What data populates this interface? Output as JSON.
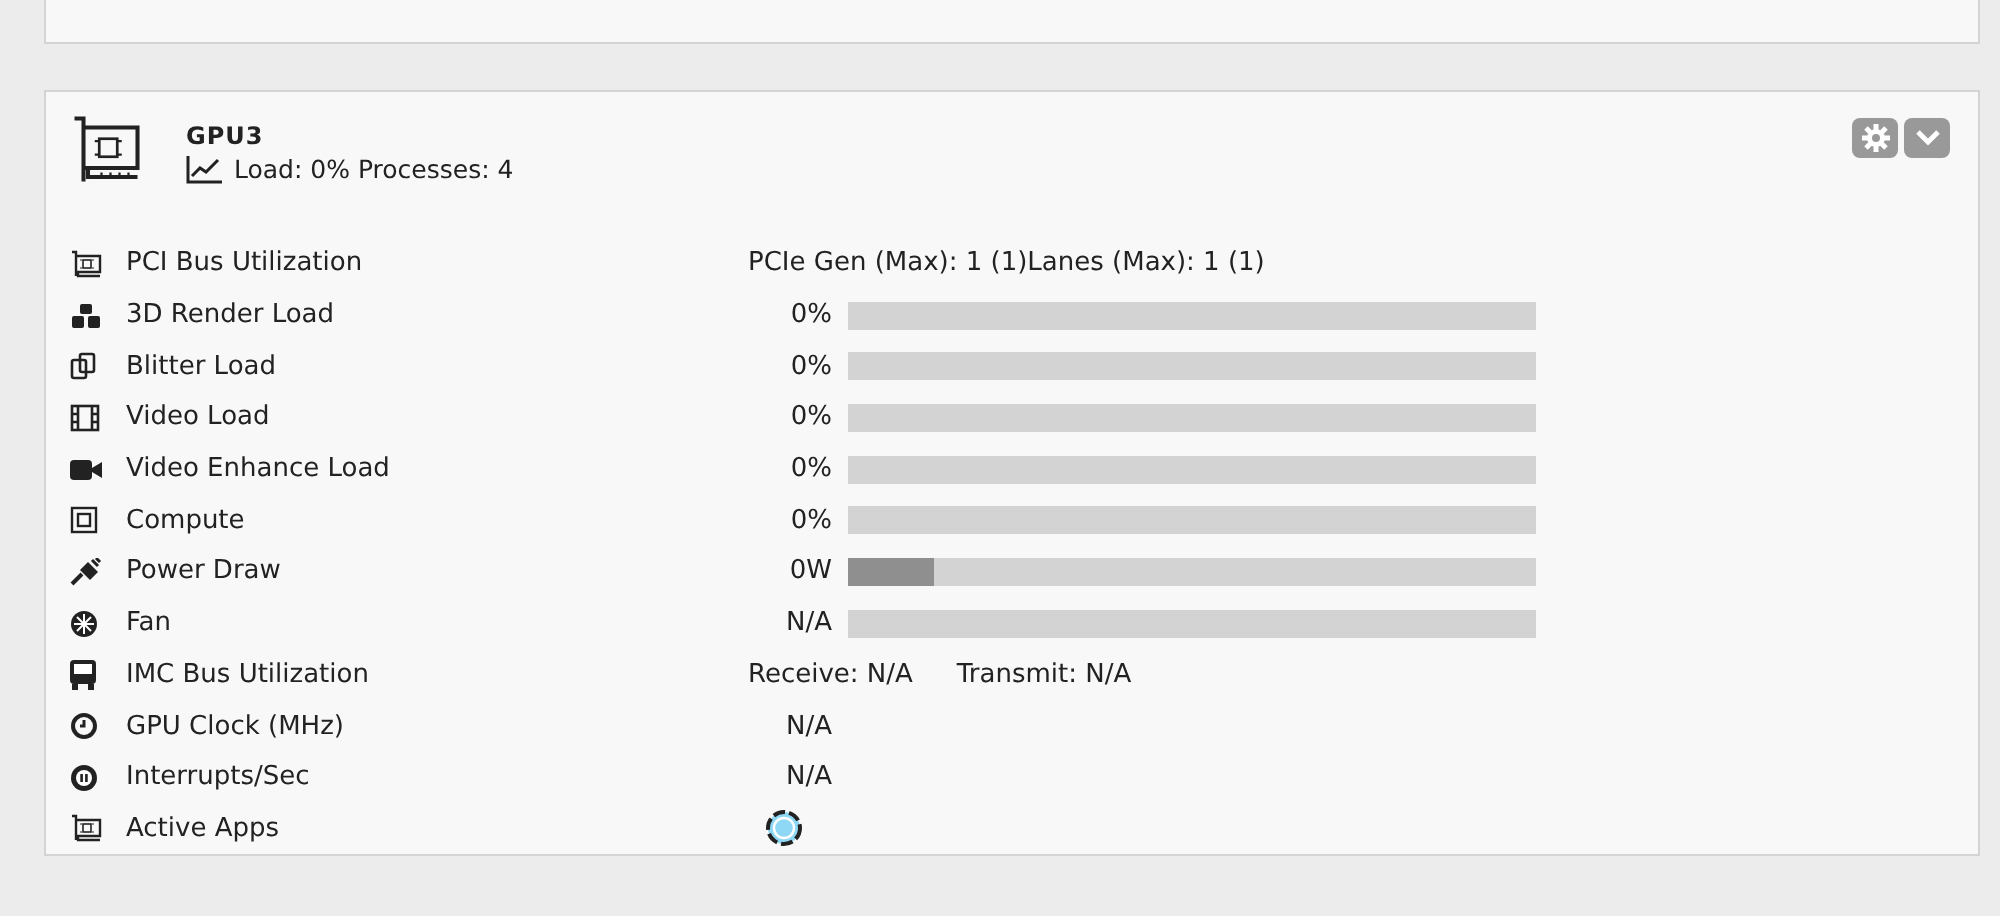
{
  "device": {
    "title": "GPU3",
    "summary": "Load: 0% Processes: 4"
  },
  "metrics": [
    {
      "kind": "text",
      "label": "PCI Bus Utilization",
      "value": "PCIe Gen (Max): 1 (1)Lanes (Max): 1 (1)"
    },
    {
      "kind": "bar",
      "label": "3D Render Load",
      "value": "0%",
      "level": 0
    },
    {
      "kind": "bar",
      "label": "Blitter Load",
      "value": "0%",
      "level": 0
    },
    {
      "kind": "bar",
      "label": "Video Load",
      "value": "0%",
      "level": 0
    },
    {
      "kind": "bar",
      "label": "Video Enhance Load",
      "value": "0%",
      "level": 0
    },
    {
      "kind": "bar",
      "label": "Compute",
      "value": "0%",
      "level": 0
    },
    {
      "kind": "bar",
      "label": "Power Draw",
      "value": "0W",
      "level": 0.125
    },
    {
      "kind": "bar",
      "label": "Fan",
      "value": "N/A",
      "level": 0
    },
    {
      "kind": "pair",
      "label": "IMC Bus Utilization",
      "value": "Receive: N/A",
      "value2": "Transmit: N/A"
    },
    {
      "kind": "reading",
      "label": "GPU Clock (MHz)",
      "value": "N/A"
    },
    {
      "kind": "reading",
      "label": "Interrupts/Sec",
      "value": "N/A"
    },
    {
      "kind": "spinner",
      "label": "Active Apps"
    }
  ]
}
